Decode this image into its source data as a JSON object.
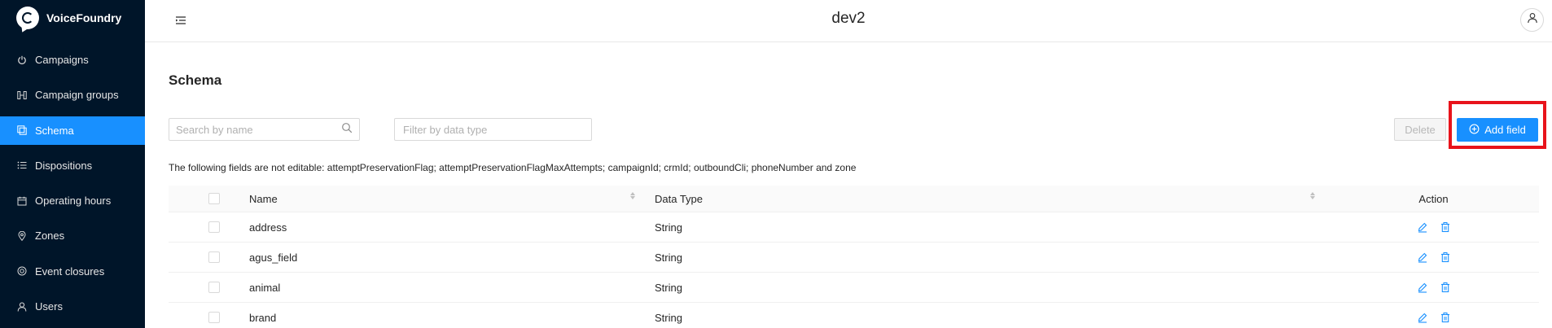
{
  "app": {
    "name": "VoiceFoundry"
  },
  "sidebar": {
    "items": [
      {
        "label": "Campaigns",
        "icon": "power-icon"
      },
      {
        "label": "Campaign groups",
        "icon": "campaign-groups-icon"
      },
      {
        "label": "Schema",
        "icon": "schema-icon",
        "active": true
      },
      {
        "label": "Dispositions",
        "icon": "list-icon"
      },
      {
        "label": "Operating hours",
        "icon": "calendar-icon"
      },
      {
        "label": "Zones",
        "icon": "location-pin-icon"
      },
      {
        "label": "Event closures",
        "icon": "target-icon"
      },
      {
        "label": "Users",
        "icon": "user-icon"
      }
    ]
  },
  "header": {
    "title": "dev2"
  },
  "page": {
    "title": "Schema",
    "search_placeholder": "Search by name",
    "filter_placeholder": "Filter by data type",
    "delete_label": "Delete",
    "add_label": "Add field",
    "note": "The following fields are not editable: attemptPreservationFlag; attemptPreservationFlagMaxAttempts; campaignId; crmId; outboundCli; phoneNumber and zone"
  },
  "table": {
    "columns": {
      "name": "Name",
      "type": "Data Type",
      "action": "Action"
    },
    "rows": [
      {
        "name": "address",
        "type": "String"
      },
      {
        "name": "agus_field",
        "type": "String"
      },
      {
        "name": "animal",
        "type": "String"
      },
      {
        "name": "brand",
        "type": "String"
      }
    ]
  },
  "colors": {
    "sidebar_bg": "#001529",
    "accent": "#1890ff",
    "highlight": "#e8131b"
  }
}
